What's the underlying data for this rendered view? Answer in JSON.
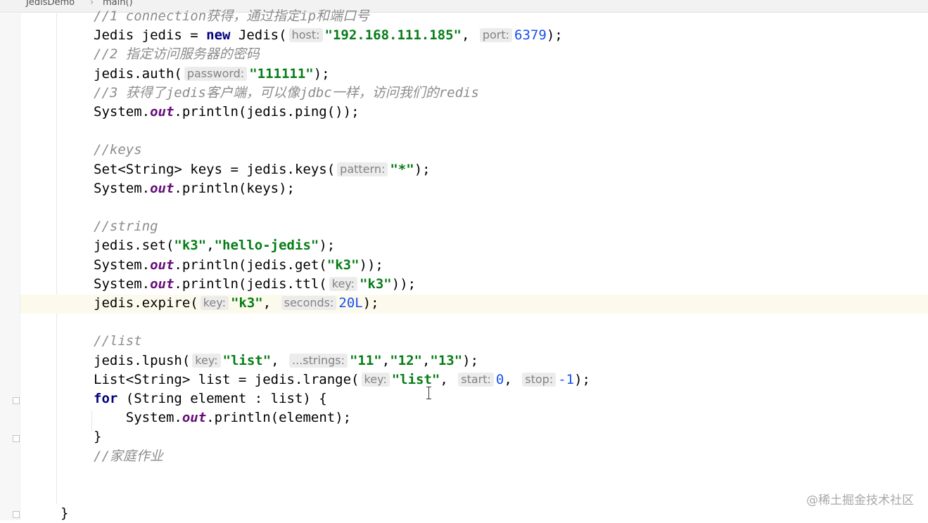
{
  "breadcrumb": {
    "items": [
      "JedisDemo",
      "main()"
    ],
    "separator": "›"
  },
  "code_lines": [
    [
      {
        "t": "//1 connection获得，通过指定ip和端口号",
        "c": "cmt"
      }
    ],
    [
      {
        "t": "Jedis jedis = "
      },
      {
        "t": "new",
        "c": "kw"
      },
      {
        "t": " Jedis("
      },
      {
        "t": "host:",
        "c": "hint"
      },
      {
        "t": "\"192.168.111.185\"",
        "c": "str"
      },
      {
        "t": ", "
      },
      {
        "t": "port:",
        "c": "hint"
      },
      {
        "t": "6379",
        "c": "num"
      },
      {
        "t": ");"
      }
    ],
    [
      {
        "t": "//2 指定访问服务器的密码",
        "c": "cmt"
      }
    ],
    [
      {
        "t": "jedis.auth("
      },
      {
        "t": "password:",
        "c": "hint"
      },
      {
        "t": "\"111111\"",
        "c": "str"
      },
      {
        "t": ");"
      }
    ],
    [
      {
        "t": "//3 获得了jedis客户端，可以像jdbc一样，访问我们的redis",
        "c": "cmt"
      }
    ],
    [
      {
        "t": "System."
      },
      {
        "t": "out",
        "c": "fld"
      },
      {
        "t": ".println(jedis.ping());"
      }
    ],
    [],
    [
      {
        "t": "//keys",
        "c": "cmt"
      }
    ],
    [
      {
        "t": "Set<String> keys = jedis.keys("
      },
      {
        "t": "pattern:",
        "c": "hint"
      },
      {
        "t": "\"*\"",
        "c": "str"
      },
      {
        "t": ");"
      }
    ],
    [
      {
        "t": "System."
      },
      {
        "t": "out",
        "c": "fld"
      },
      {
        "t": ".println(keys);"
      }
    ],
    [],
    [
      {
        "t": "//string",
        "c": "cmt"
      }
    ],
    [
      {
        "t": "jedis.set("
      },
      {
        "t": "\"k3\"",
        "c": "str"
      },
      {
        "t": ","
      },
      {
        "t": "\"hello-jedis\"",
        "c": "str"
      },
      {
        "t": ");"
      }
    ],
    [
      {
        "t": "System."
      },
      {
        "t": "out",
        "c": "fld"
      },
      {
        "t": ".println(jedis.get("
      },
      {
        "t": "\"k3\"",
        "c": "str"
      },
      {
        "t": "));"
      }
    ],
    [
      {
        "t": "System."
      },
      {
        "t": "out",
        "c": "fld"
      },
      {
        "t": ".println(jedis.ttl("
      },
      {
        "t": "key:",
        "c": "hint"
      },
      {
        "t": "\"k3\"",
        "c": "str"
      },
      {
        "t": "));"
      }
    ],
    [
      {
        "t": "jedis.expire("
      },
      {
        "t": "key:",
        "c": "hint"
      },
      {
        "t": "\"k3\"",
        "c": "str"
      },
      {
        "t": ", "
      },
      {
        "t": "seconds:",
        "c": "hint"
      },
      {
        "t": "20L",
        "c": "num"
      },
      {
        "t": ");"
      }
    ],
    [],
    [
      {
        "t": "//list",
        "c": "cmt"
      }
    ],
    [
      {
        "t": "jedis.lpush("
      },
      {
        "t": "key:",
        "c": "hint"
      },
      {
        "t": "\"list\"",
        "c": "str"
      },
      {
        "t": ", "
      },
      {
        "t": "...strings:",
        "c": "hint"
      },
      {
        "t": "\"11\"",
        "c": "str"
      },
      {
        "t": ","
      },
      {
        "t": "\"12\"",
        "c": "str"
      },
      {
        "t": ","
      },
      {
        "t": "\"13\"",
        "c": "str"
      },
      {
        "t": ");"
      }
    ],
    [
      {
        "t": "List<String> list = jedis.lrange("
      },
      {
        "t": "key:",
        "c": "hint"
      },
      {
        "t": "\"list\"",
        "c": "str"
      },
      {
        "t": ", "
      },
      {
        "t": "start:",
        "c": "hint"
      },
      {
        "t": "0",
        "c": "num"
      },
      {
        "t": ", "
      },
      {
        "t": "stop:",
        "c": "hint"
      },
      {
        "t": "-1",
        "c": "num"
      },
      {
        "t": ");"
      }
    ],
    [
      {
        "t": "for",
        "c": "kw"
      },
      {
        "t": " (String element : list) {"
      }
    ],
    [
      {
        "t": "    System."
      },
      {
        "t": "out",
        "c": "fld"
      },
      {
        "t": ".println(element);"
      }
    ],
    [
      {
        "t": "}"
      }
    ],
    [
      {
        "t": "//家庭作业",
        "c": "cmt"
      }
    ],
    [],
    [],
    [
      {
        "t": "}"
      }
    ]
  ],
  "watermark": "@稀土掘金技术社区",
  "colors": {
    "keyword": "#000080",
    "string": "#067d17",
    "number": "#1750eb",
    "comment": "#8c8c8c",
    "field": "#660e7a",
    "caret_row": "#fcfaed"
  }
}
